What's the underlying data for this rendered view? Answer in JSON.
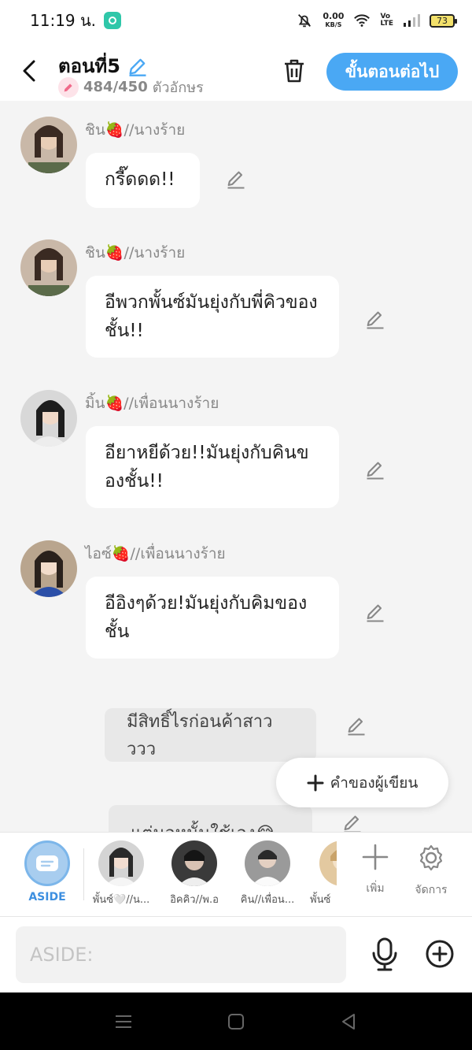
{
  "status": {
    "time": "11:19 น.",
    "speed_value": "0.00",
    "speed_unit": "KB/S",
    "lte_top": "Vo",
    "lte_bottom": "LTE",
    "battery": "73"
  },
  "header": {
    "title": "ตอนที่5",
    "char_count": "484/450",
    "char_label": "ตัวอักษร",
    "next_label": "ขั้นตอนต่อไป"
  },
  "messages": [
    {
      "name": "ชิน🍓//นางร้าย",
      "text": "กรี๊ดดด!!"
    },
    {
      "name": "ชิน🍓//นางร้าย",
      "text": "อีพวกพั้นซ์มันยุ่งกับพี่คิวของชั้น!!"
    },
    {
      "name": "มิ้น🍓//เพื่อนนางร้าย",
      "text": "อียาหยีด้วย!!มันยุ่งกับคินของชั้น!!"
    },
    {
      "name": "ไอซ์🍓//เพื่อนนางร้าย",
      "text": "อีอิงๆด้วย!มันยุ่งกับคิมของชั้น"
    }
  ],
  "asides": [
    {
      "text": "มีสิทธิ์ไรก่อนค้าสาวววว"
    },
    {
      "text": "แต่นอหนั้นใช้เอง😂"
    }
  ],
  "author_words_label": "คำของผู้เขียน",
  "char_bar": {
    "aside_label": "ASIDE",
    "characters": [
      {
        "label": "พั้นซ์🤍//น..."
      },
      {
        "label": "อิคคิว//พ.อ"
      },
      {
        "label": "คิน//เพื่อน..."
      },
      {
        "label": "พั้นซ์"
      }
    ],
    "add_label": "เพิ่ม",
    "manage_label": "จัดการ"
  },
  "input": {
    "placeholder": "ASIDE:"
  },
  "colors": {
    "accent": "#4aa8f4",
    "aside_ring": "#7cb6ea",
    "strawberry": "#e53935"
  }
}
